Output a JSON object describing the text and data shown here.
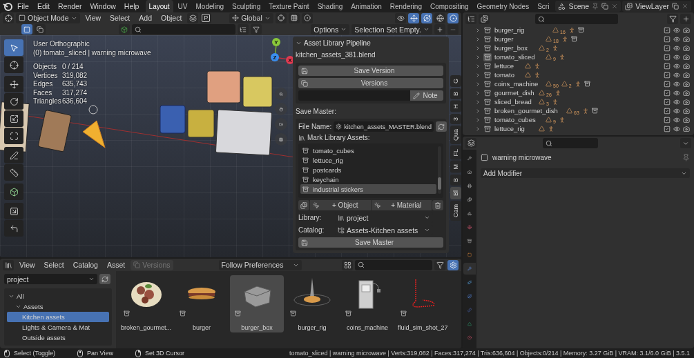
{
  "topbar": {
    "menus": [
      "File",
      "Edit",
      "Render",
      "Window",
      "Help"
    ],
    "workspaces": [
      {
        "label": "Layout",
        "selected": true
      },
      {
        "label": "UV",
        "selected": false
      },
      {
        "label": "Modeling",
        "selected": false
      },
      {
        "label": "Sculpting",
        "selected": false
      },
      {
        "label": "Texture Paint",
        "selected": false
      },
      {
        "label": "Shading",
        "selected": false
      },
      {
        "label": "Animation",
        "selected": false
      },
      {
        "label": "Rendering",
        "selected": false
      },
      {
        "label": "Compositing",
        "selected": false
      },
      {
        "label": "Geometry Nodes",
        "selected": false
      },
      {
        "label": "Scri",
        "selected": false
      }
    ],
    "scene": "Scene",
    "view_layer": "ViewLayer"
  },
  "viewport": {
    "mode": "Object Mode",
    "menus": [
      "View",
      "Select",
      "Add",
      "Object"
    ],
    "orientation": "Global",
    "pivot_key": "P",
    "options": "Options",
    "selection_set": "Selection Set Empty.",
    "tools": [
      {
        "kind": "select",
        "selected": true
      },
      {
        "kind": "cursor",
        "selected": false
      },
      {
        "kind": "move",
        "selected": false
      },
      {
        "kind": "rotate",
        "selected": false
      },
      {
        "kind": "scale",
        "selected": false
      },
      {
        "kind": "transform",
        "selected": false
      },
      {
        "kind": "annotate",
        "selected": false
      },
      {
        "kind": "measure",
        "selected": false
      },
      {
        "kind": "add_cube",
        "selected": false
      },
      {
        "kind": "shrink",
        "selected": false
      },
      {
        "kind": "bend",
        "selected": false
      }
    ],
    "view_name": "User Orthographic",
    "context": "(0) tomato_sliced | warning microwave",
    "stats": [
      {
        "label": "Objects",
        "value": "0 / 214"
      },
      {
        "label": "Vertices",
        "value": "319,082"
      },
      {
        "label": "Edges",
        "value": "635,743"
      },
      {
        "label": "Faces",
        "value": "317,274"
      },
      {
        "label": "Triangles",
        "value": "636,604"
      }
    ],
    "gizmo": {
      "x": "X",
      "y": "Y",
      "z": "Z"
    }
  },
  "asset_panel": {
    "title": "Asset Library Pipeline",
    "expanded": true,
    "file": "kitchen_assets_381.blend",
    "save_version": "Save Version",
    "versions": "Versions",
    "note_button": "Note",
    "save_master_label": "Save Master:",
    "file_name_label": "File Name:",
    "file_name": "kitchen_assets_MASTER.blend",
    "mark_label": "Mark Library Assets:",
    "assets": [
      {
        "name": "tomato_cubes",
        "selected": false
      },
      {
        "name": "lettuce_rig",
        "selected": false
      },
      {
        "name": "postcards",
        "selected": false
      },
      {
        "name": "keychain",
        "selected": false
      },
      {
        "name": "industrial stickers",
        "selected": true
      }
    ],
    "add_object": "+ Object",
    "add_material": "+ Material",
    "library_label": "Library:",
    "library": "project",
    "catalog_label": "Catalog:",
    "catalog": "Assets-Kitchen assets",
    "save_master": "Save Master"
  },
  "side_tabs": [
    {
      "label": "G",
      "selected": false
    },
    {
      "label": "B",
      "selected": false
    },
    {
      "label": "H",
      "selected": false
    },
    {
      "label": "3",
      "selected": false
    },
    {
      "label": "Qua",
      "selected": false
    },
    {
      "label": "FL",
      "selected": false
    },
    {
      "label": "M",
      "selected": false
    },
    {
      "label": "B",
      "selected": false
    },
    {
      "label": "Bl",
      "selected": true
    },
    {
      "label": "Cam",
      "selected": false
    }
  ],
  "outliner": {
    "rows": [
      {
        "name": "burger_rig",
        "counts": [
          "16"
        ],
        "collection": true,
        "selected": false,
        "checked": true
      },
      {
        "name": "burger",
        "counts": [
          "18"
        ],
        "collection": true,
        "selected": false,
        "checked": true
      },
      {
        "name": "burger_box",
        "counts": [
          "2"
        ],
        "collection": false,
        "selected": false,
        "checked": true
      },
      {
        "name": "tomato_sliced",
        "counts": [
          "9"
        ],
        "collection": false,
        "selected": true,
        "checked": true
      },
      {
        "name": "lettuce",
        "counts": [],
        "collection": false,
        "selected": false,
        "checked": true
      },
      {
        "name": "tomato",
        "counts": [],
        "collection": false,
        "selected": false,
        "checked": true
      },
      {
        "name": "coins_machine",
        "counts": [
          "50",
          "2"
        ],
        "collection": true,
        "selected": false,
        "checked": true
      },
      {
        "name": "gourmet_dish",
        "counts": [
          "26"
        ],
        "collection": false,
        "selected": false,
        "checked": true
      },
      {
        "name": "sliced_bread",
        "counts": [
          "3"
        ],
        "collection": false,
        "selected": false,
        "checked": true
      },
      {
        "name": "broken_gourmet_dish",
        "counts": [
          "63"
        ],
        "collection": true,
        "selected": false,
        "checked": true
      },
      {
        "name": "tomato_cubes",
        "counts": [
          "9"
        ],
        "collection": false,
        "selected": false,
        "checked": true
      },
      {
        "name": "lettuce_rig",
        "counts": [],
        "collection": false,
        "selected": false,
        "checked": true
      }
    ]
  },
  "properties": {
    "object": "warning microwave",
    "add_modifier": "Add Modifier",
    "tabs": [
      {
        "kind": "tool",
        "selected": false
      },
      {
        "kind": "render",
        "selected": false
      },
      {
        "kind": "output",
        "selected": false
      },
      {
        "kind": "view_layer",
        "selected": false
      },
      {
        "kind": "scene",
        "selected": false
      },
      {
        "kind": "world",
        "selected": false
      },
      {
        "kind": "collection",
        "selected": false
      },
      {
        "kind": "object",
        "selected": false
      },
      {
        "kind": "modifier",
        "selected": true
      },
      {
        "kind": "particles",
        "selected": false
      },
      {
        "kind": "physics",
        "selected": false
      },
      {
        "kind": "constraints",
        "selected": false
      },
      {
        "kind": "data",
        "selected": false
      },
      {
        "kind": "material",
        "selected": false
      }
    ]
  },
  "asset_browser": {
    "menus": [
      "View",
      "Select",
      "Catalog",
      "Asset"
    ],
    "versions": {
      "label": "Versions",
      "disabled": true
    },
    "import_method": "Follow Preferences",
    "library": "project",
    "catalogs": [
      {
        "label": "All",
        "expanded": true,
        "selected": false,
        "children": [
          {
            "label": "Assets",
            "expanded": true,
            "selected": false,
            "children": [
              {
                "label": "Kitchen assets",
                "selected": true
              },
              {
                "label": "Lights & Camera & Mat",
                "selected": false
              },
              {
                "label": "Outside assets",
                "selected": false
              }
            ]
          }
        ]
      }
    ],
    "assets": [
      {
        "name": "broken_gourmet...",
        "kind": "dish",
        "selected": false
      },
      {
        "name": "burger",
        "kind": "burger",
        "selected": false
      },
      {
        "name": "burger_box",
        "kind": "box",
        "selected": true
      },
      {
        "name": "burger_rig",
        "kind": "rig",
        "selected": false
      },
      {
        "name": "coins_machine",
        "kind": "machine",
        "selected": false
      },
      {
        "name": "fluid_sim_shot_27",
        "kind": "fluid",
        "selected": false
      }
    ]
  },
  "status_bar": {
    "hints": [
      {
        "kind": "left",
        "label": "Select (Toggle)"
      },
      {
        "kind": "middle",
        "label": "Pan View"
      },
      {
        "kind": "right",
        "label": "Set 3D Cursor"
      }
    ],
    "stats": "tomato_sliced | warning microwave | Verts:319,082 | Faces:317,274 | Tris:636,604 | Objects:0/214 | Memory: 3.27 GiB | VRAM: 3.1/6.0 GiB | 3.5.1"
  }
}
